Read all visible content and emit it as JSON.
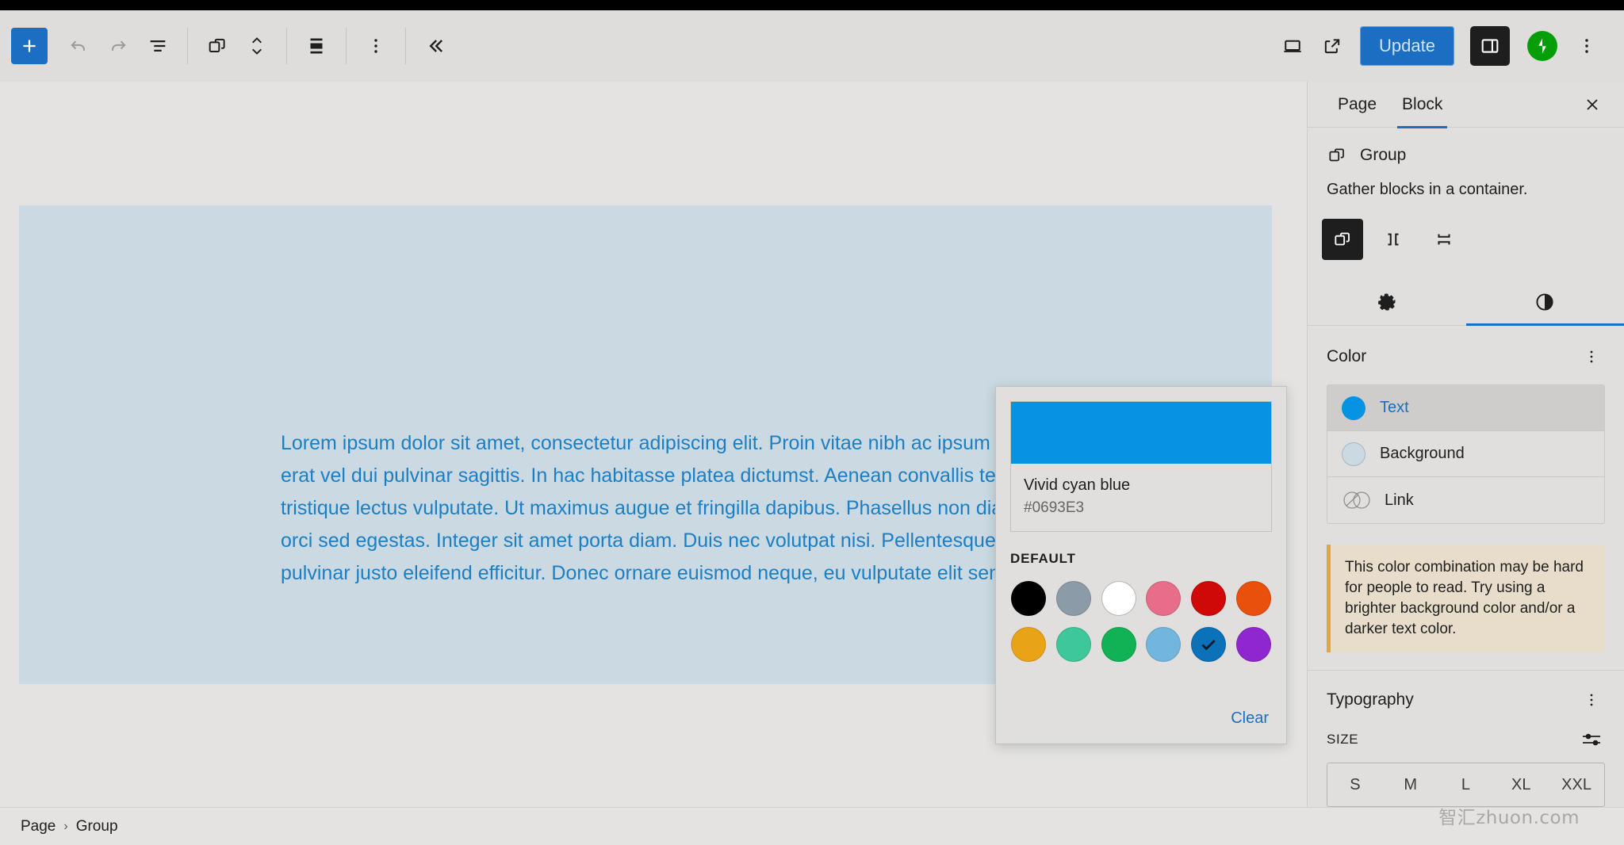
{
  "toolbar": {
    "add_block_label": "Add block",
    "undo_label": "Undo",
    "redo_label": "Redo",
    "list_view_label": "Document Overview",
    "block_type_label": "Group",
    "move_label": "Move up or down",
    "align_label": "Align",
    "options_label": "Options",
    "collapse_label": "Collapse",
    "preview_label": "Preview",
    "view_label": "View Post",
    "update_label": "Update",
    "settings_toggle_label": "Settings",
    "jetpack_label": "Jetpack",
    "more_label": "Options",
    "accent": "#1b6ec2"
  },
  "canvas": {
    "group_background": "#CBD9E2",
    "paragraph_color": "#1b7fc4",
    "paragraph": "Lorem ipsum dolor sit amet, consectetur adipiscing elit. Proin vitae nibh ac ipsum consectetur sagittis. Morbi in erat vel dui pulvinar sagittis. In hac habitasse platea dictumst. Aenean convallis tellus eget orci cursus, id tristique lectus vulputate. Ut maximus augue et fringilla dapibus. Phasellus non diam sem. Donec congue eu orci sed egestas. Integer sit amet porta diam. Duis nec volutpat nisi. Pellentesque accumsan eros metus, nec pulvinar justo eleifend efficitur. Donec ornare euismod neque, eu vulputate elit semper et."
  },
  "breadcrumb": {
    "items": [
      "Page",
      "Group"
    ],
    "separator": "›"
  },
  "watermark": "智汇zhuon.com",
  "sidebar": {
    "tabs": [
      {
        "label": "Page",
        "active": false
      },
      {
        "label": "Block",
        "active": true
      }
    ],
    "close_label": "Close Settings",
    "block": {
      "name": "Group",
      "description": "Gather blocks in a container.",
      "variations": [
        {
          "name": "group-default",
          "active": true
        },
        {
          "name": "group-row",
          "active": false
        },
        {
          "name": "group-stack",
          "active": false
        }
      ]
    },
    "icon_tabs": [
      {
        "name": "settings",
        "active": false
      },
      {
        "name": "styles",
        "active": true
      }
    ],
    "color_panel": {
      "title": "Color",
      "more_label": "Color options",
      "rows": [
        {
          "label": "Text",
          "swatch": "#0693E3",
          "selected": true,
          "kind": "solid"
        },
        {
          "label": "Background",
          "swatch": "#CBD9E2",
          "selected": false,
          "kind": "solid"
        },
        {
          "label": "Link",
          "swatch": "",
          "selected": false,
          "kind": "link"
        }
      ]
    },
    "notice": {
      "text": "This color combination may be hard for people to read. Try using a brighter background color and/or a darker text color.",
      "accent": "#e7a33e",
      "background": "#e8ddcb"
    },
    "typography_panel": {
      "title": "Typography",
      "more_label": "Typography options",
      "size_label": "SIZE",
      "sizes": [
        "S",
        "M",
        "L",
        "XL",
        "XXL"
      ]
    }
  },
  "color_popover": {
    "preview_color": "#0693E3",
    "preview_name": "Vivid cyan blue",
    "preview_hex": "#0693E3",
    "group_label": "DEFAULT",
    "clear_label": "Clear",
    "swatches": [
      {
        "name": "Black",
        "hex": "#000000",
        "selected": false
      },
      {
        "name": "Cyan bluish gray",
        "hex": "#8c9ba8",
        "selected": false
      },
      {
        "name": "White",
        "hex": "#FFFFFF",
        "selected": false
      },
      {
        "name": "Pale pink",
        "hex": "#e76d8a",
        "selected": false
      },
      {
        "name": "Vivid red",
        "hex": "#cf0808",
        "selected": false
      },
      {
        "name": "Luminous vivid orange",
        "hex": "#e8500c",
        "selected": false
      },
      {
        "name": "Luminous vivid amber",
        "hex": "#e8a317",
        "selected": false
      },
      {
        "name": "Light green cyan",
        "hex": "#3ec79a",
        "selected": false
      },
      {
        "name": "Vivid green cyan",
        "hex": "#11b256",
        "selected": false
      },
      {
        "name": "Pale cyan blue",
        "hex": "#72b6de",
        "selected": false
      },
      {
        "name": "Vivid cyan blue",
        "hex": "#0b71b9",
        "selected": true
      },
      {
        "name": "Vivid purple",
        "hex": "#9026cf",
        "selected": false
      }
    ]
  }
}
